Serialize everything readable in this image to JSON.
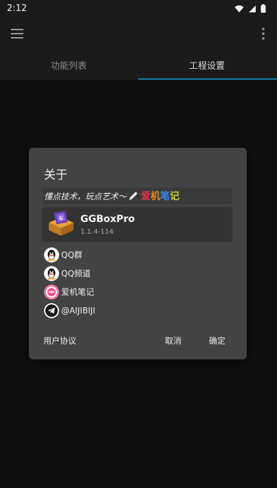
{
  "status": {
    "time": "2:12"
  },
  "tabs": [
    {
      "label": "功能列表",
      "active": false
    },
    {
      "label": "工程设置",
      "active": true
    }
  ],
  "dialog": {
    "title": "关于",
    "slogan": "懂点技术，玩点艺术～",
    "brand_chars": [
      {
        "char": "爱",
        "color": "#e8324a"
      },
      {
        "char": "机",
        "color": "#f08a1e"
      },
      {
        "char": "笔",
        "color": "#3a8be8"
      },
      {
        "char": "记",
        "color": "#cbd534"
      }
    ],
    "app": {
      "name": "GGBoxPro",
      "version": "1.1.4-114"
    },
    "links": [
      {
        "label": "QQ群",
        "icon": "qq-icon"
      },
      {
        "label": "QQ频道",
        "icon": "qq-icon"
      },
      {
        "label": "爱机笔记",
        "icon": "aijibiji-icon"
      },
      {
        "label": "@AIJIBIJI",
        "icon": "telegram-icon"
      }
    ],
    "buttons": {
      "agreement": "用户协议",
      "cancel": "取消",
      "ok": "确定"
    }
  },
  "colors": {
    "accent": "#1a7fa3",
    "dialog_bg": "#434343",
    "background": "#0f0f0f"
  }
}
